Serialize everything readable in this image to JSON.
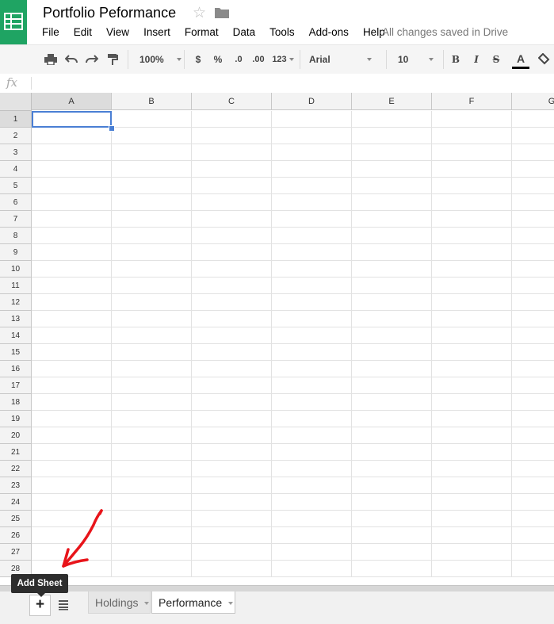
{
  "doc": {
    "title": "Portfolio Peformance",
    "save_status": "All changes saved in Drive"
  },
  "menu": [
    "File",
    "Edit",
    "View",
    "Insert",
    "Format",
    "Data",
    "Tools",
    "Add-ons",
    "Help"
  ],
  "toolbar": {
    "zoom": "100%",
    "currency": "$",
    "percent": "%",
    "dec_decrease": ".0",
    "dec_increase": ".00",
    "more_formats": "123",
    "font": "Arial",
    "font_size": "10",
    "bold": "B",
    "italic": "I",
    "strikethrough": "S",
    "text_color": "A",
    "text_color_value": "#000000"
  },
  "formula_bar": {
    "fx": "fx",
    "value": ""
  },
  "grid": {
    "columns": [
      "A",
      "B",
      "C",
      "D",
      "E",
      "F",
      "G"
    ],
    "rows": [
      "1",
      "2",
      "3",
      "4",
      "5",
      "6",
      "7",
      "8",
      "9",
      "10",
      "11",
      "12",
      "13",
      "14",
      "15",
      "16",
      "17",
      "18",
      "19",
      "20",
      "21",
      "22",
      "23",
      "24",
      "25",
      "26",
      "27",
      "28"
    ],
    "active_cell": "A1"
  },
  "sheets": {
    "add_tooltip": "Add Sheet",
    "tabs": [
      {
        "label": "Holdings",
        "active": false
      },
      {
        "label": "Performance",
        "active": true
      }
    ]
  },
  "colors": {
    "brand": "#1fa463",
    "selection": "#4a7fd4",
    "annotation": "#e8141a"
  }
}
